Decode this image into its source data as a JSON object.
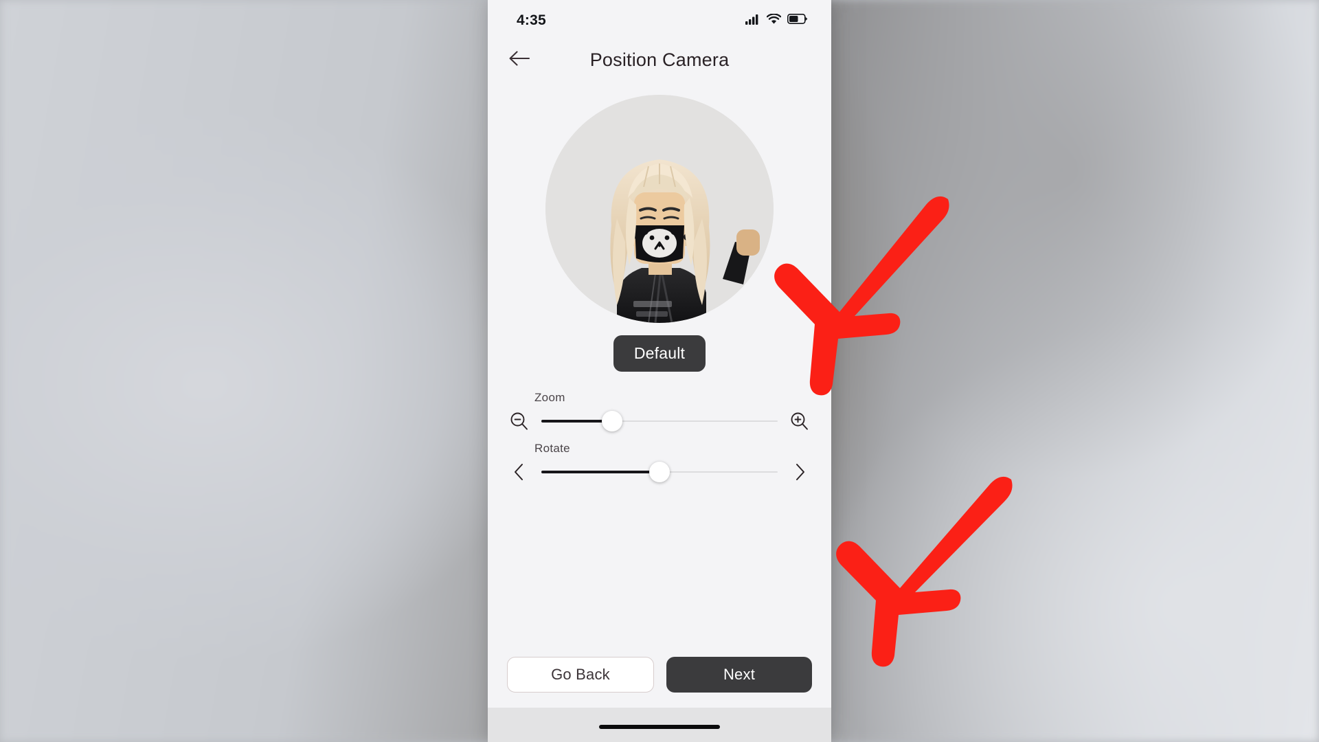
{
  "statusbar": {
    "time": "4:35",
    "icons": [
      "cellular-signal-icon",
      "wifi-icon",
      "battery-icon"
    ]
  },
  "header": {
    "back_icon": "arrow-left-icon",
    "title": "Position Camera"
  },
  "avatar": {
    "name": "roblox-avatar-preview",
    "description": "Roblox avatar with blonde hair, black face mask with white bear face, black jacket",
    "background_color": "#e2e1e0"
  },
  "default_button": {
    "label": "Default",
    "background": "#3b3b3d",
    "text_color": "#ffffff"
  },
  "controls": [
    {
      "name": "zoom",
      "label": "Zoom",
      "left_icon": "zoom-out-icon",
      "right_icon": "zoom-in-icon",
      "value_percent": 30
    },
    {
      "name": "rotate",
      "label": "Rotate",
      "left_icon": "chevron-left-icon",
      "right_icon": "chevron-right-icon",
      "value_percent": 50
    }
  ],
  "footer": {
    "go_back_label": "Go Back",
    "next_label": "Next"
  },
  "home_indicator": "home-indicator-bar",
  "annotations": {
    "color": "#fb2016",
    "arrows": [
      {
        "name": "red-arrow-pointing-to-zoom-slider",
        "direction": "down-left"
      },
      {
        "name": "red-arrow-pointing-to-next-button",
        "direction": "down-left"
      }
    ]
  },
  "colors": {
    "screen_bg": "#f4f4f6",
    "dark": "#3b3b3d",
    "track_fill": "#17161a",
    "track_bg": "#dcdcde",
    "annotation_red": "#fb2016"
  }
}
